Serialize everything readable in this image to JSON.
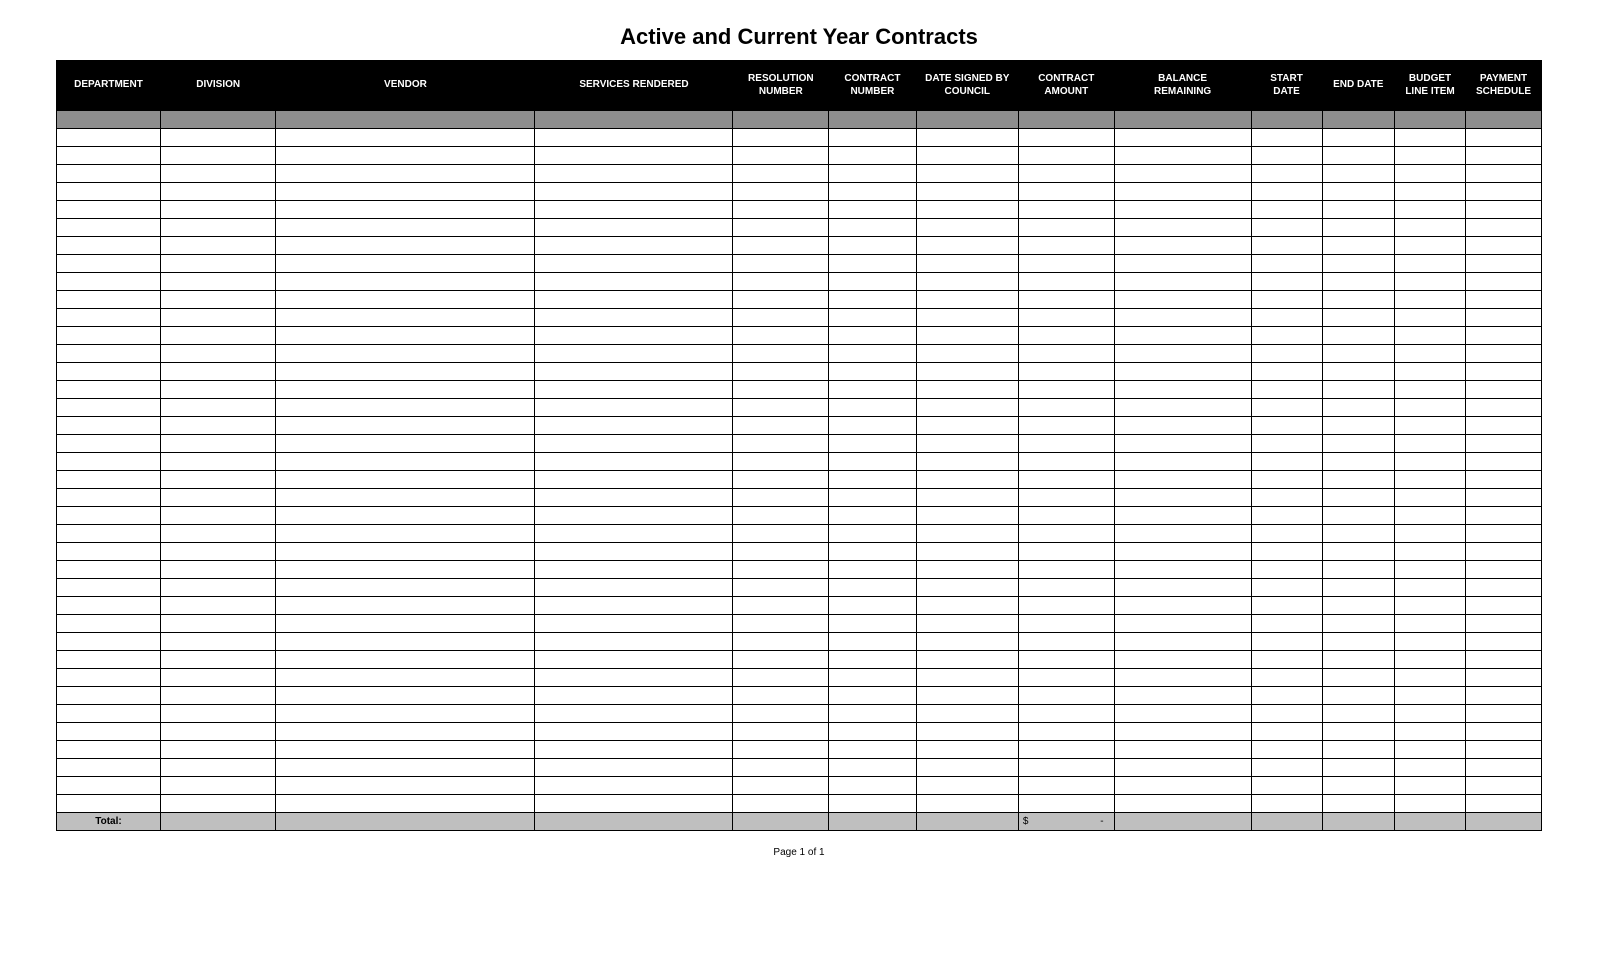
{
  "title": "Active and Current Year Contracts",
  "headers": [
    "DEPARTMENT",
    "DIVISION",
    "VENDOR",
    "SERVICES RENDERED",
    "RESOLUTION\nNUMBER",
    "CONTRACT\nNUMBER",
    "DATE SIGNED BY\nCOUNCIL",
    "CONTRACT\nAMOUNT",
    "BALANCE\nREMAINING",
    "START\nDATE",
    "END DATE",
    "BUDGET\nLINE ITEM",
    "PAYMENT\nSCHEDULE"
  ],
  "row_count": 39,
  "total": {
    "label": "Total:",
    "currency": "$",
    "value": "-"
  },
  "footer": "Page 1 of 1"
}
